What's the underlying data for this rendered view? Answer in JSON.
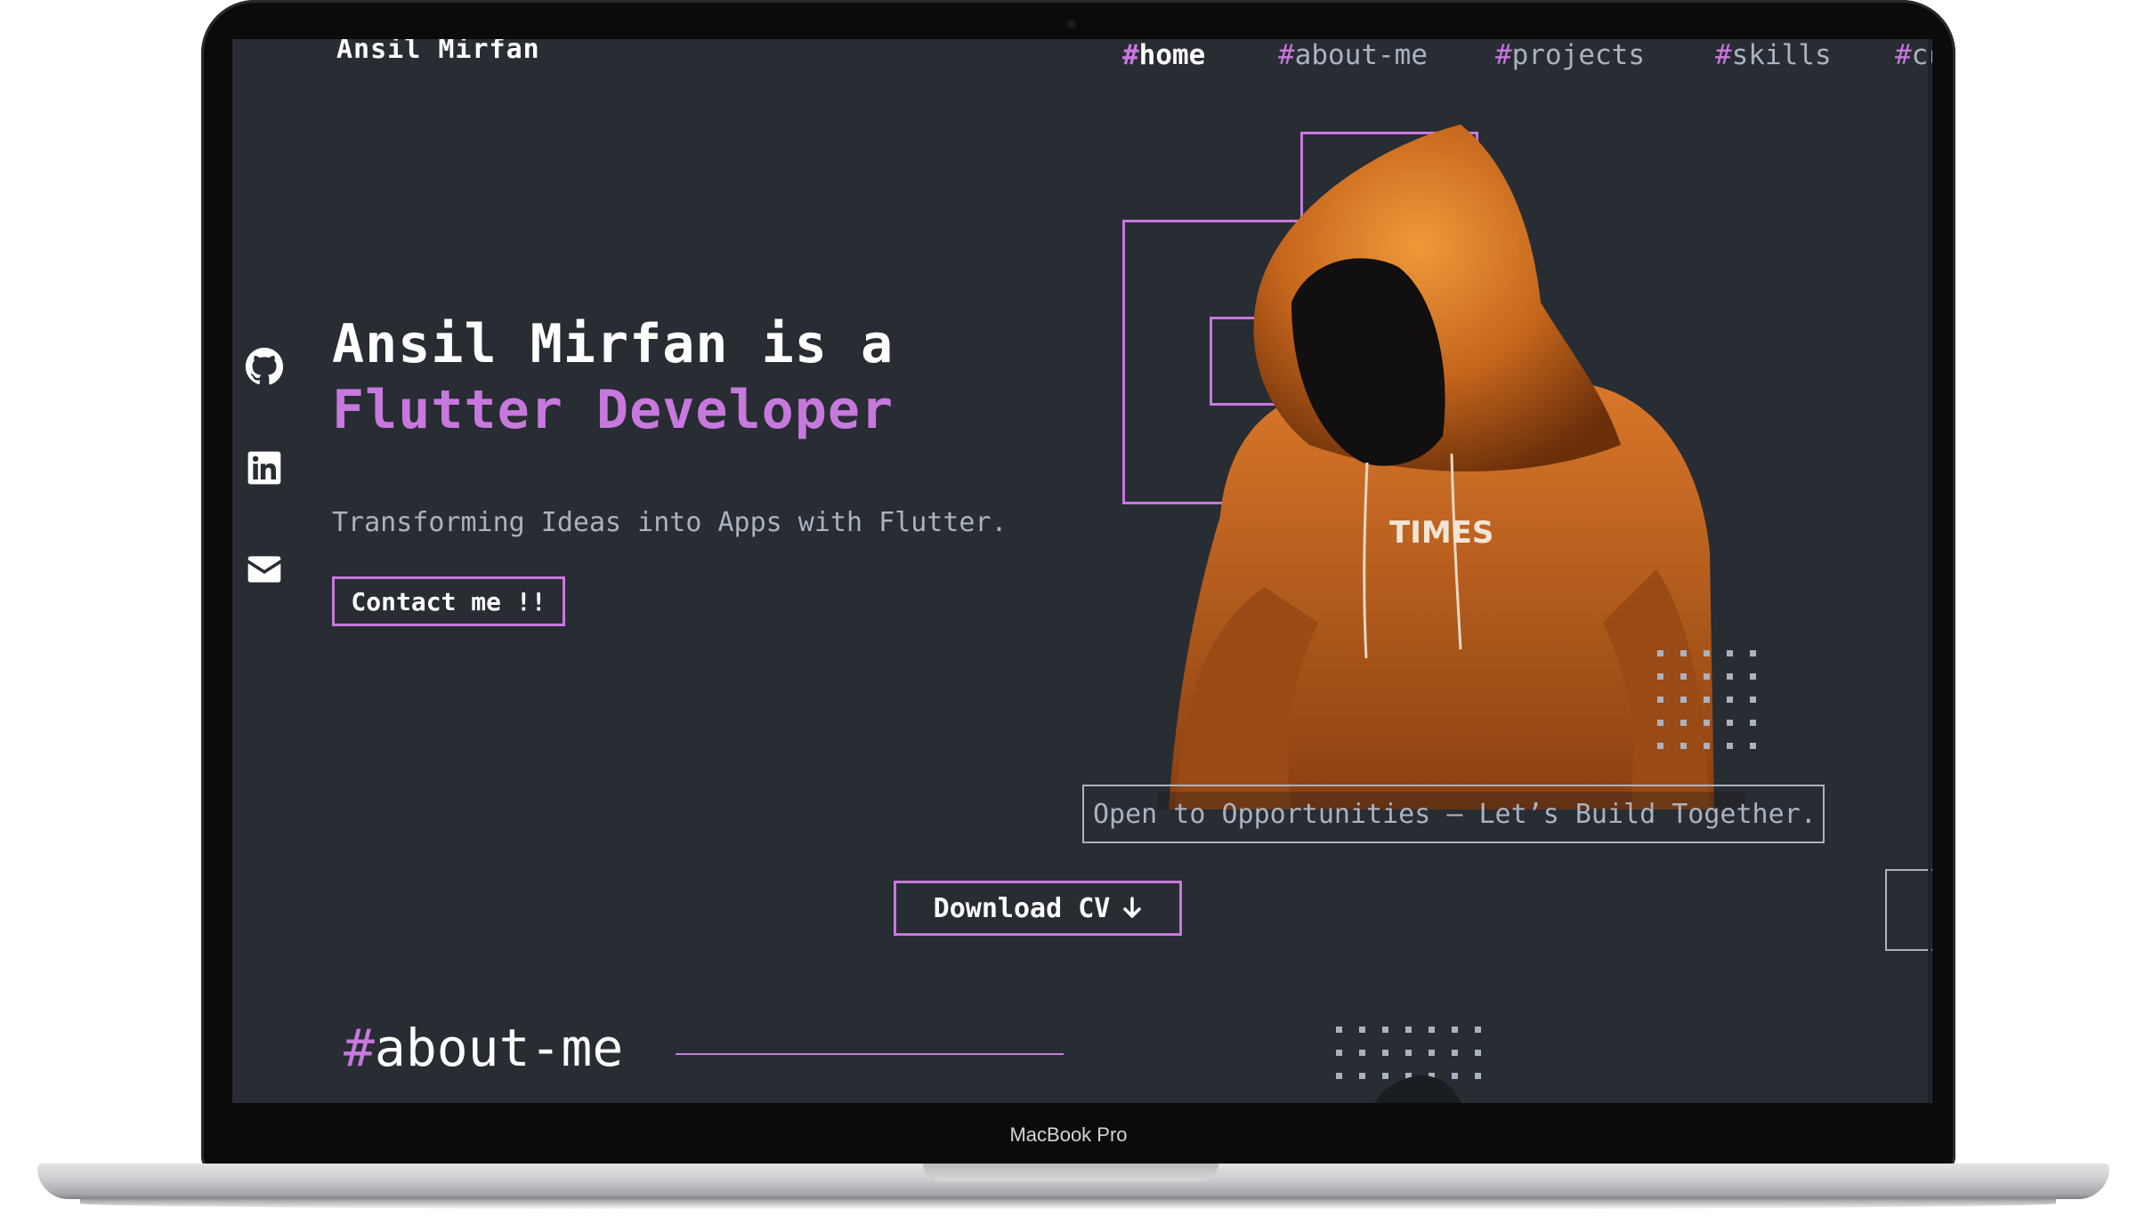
{
  "device": {
    "label": "MacBook Pro"
  },
  "header": {
    "logo": "Ansil Mirfan",
    "nav": [
      {
        "hash": "#",
        "label": "home",
        "active": true
      },
      {
        "hash": "#",
        "label": "about-me",
        "active": false
      },
      {
        "hash": "#",
        "label": "projects",
        "active": false
      },
      {
        "hash": "#",
        "label": "skills",
        "active": false
      },
      {
        "hash": "#",
        "label": "contact",
        "active": false
      }
    ]
  },
  "social": [
    {
      "icon": "github-icon"
    },
    {
      "icon": "linkedin-icon"
    },
    {
      "icon": "email-icon"
    }
  ],
  "hero": {
    "title_line1": "Ansil Mirfan is a",
    "title_line2": "Flutter Developer",
    "subtitle": "Transforming Ideas into Apps with Flutter.",
    "cta_label": "Contact me !!",
    "image_text": "TIMES",
    "status": "Open to Opportunities — Let’s Build Together."
  },
  "download": {
    "label": "Download CV",
    "icon": "arrow-down-icon"
  },
  "about": {
    "hash": "#",
    "title": "about-me"
  },
  "colors": {
    "accent": "#c778dd",
    "background": "#282c33",
    "muted": "#abb2bf",
    "hoodie": "#d9772a"
  }
}
